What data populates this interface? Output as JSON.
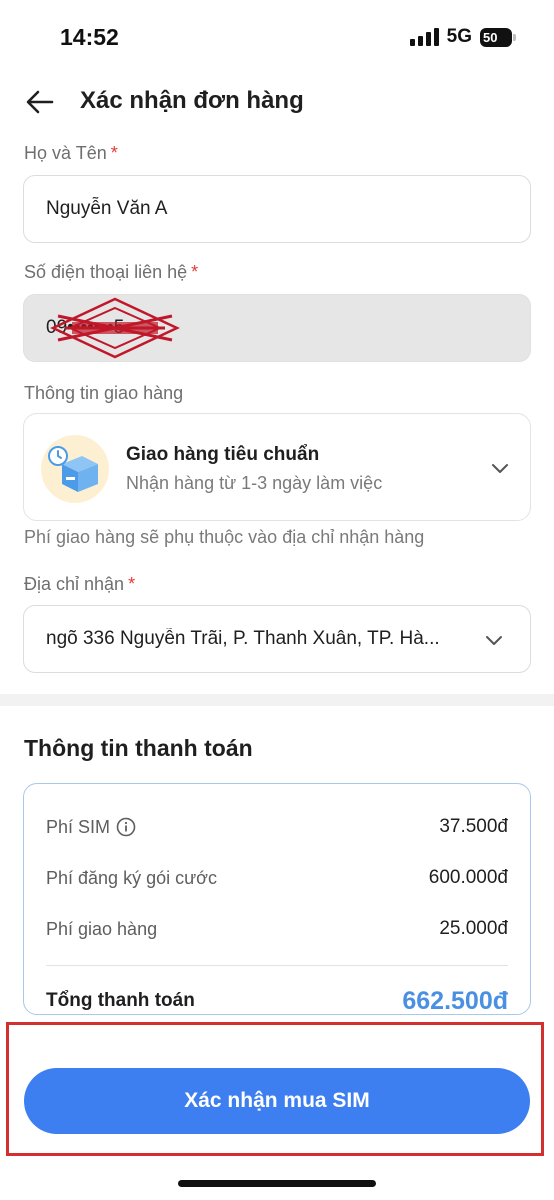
{
  "status_bar": {
    "time": "14:52",
    "network": "5G",
    "battery": "50"
  },
  "header": {
    "title": "Xác nhận đơn hàng"
  },
  "form": {
    "name_label": "Họ và Tên",
    "name_required": "*",
    "name_value": "Nguyễn Văn A",
    "phone_label": "Số điện thoại liên hệ",
    "phone_required": "*",
    "phone_value": "09•••••••5",
    "shipping_label": "Thông tin giao hàng",
    "shipping_title": "Giao hàng tiêu chuẩn",
    "shipping_subtitle": "Nhận hàng từ 1-3 ngày làm việc",
    "shipping_note": "Phí giao hàng sẽ phụ thuộc vào địa chỉ nhận hàng",
    "address_label": "Địa chỉ nhận",
    "address_required": "*",
    "address_value": "ngõ 336 Nguyễn Trãi, P. Thanh Xuân, TP. Hà..."
  },
  "payment": {
    "title": "Thông tin thanh toán",
    "rows": [
      {
        "label": "Phí SIM",
        "value": "37.500đ"
      },
      {
        "label": "Phí đăng ký gói cước",
        "value": "600.000đ"
      },
      {
        "label": "Phí giao hàng",
        "value": "25.000đ"
      }
    ],
    "total_label": "Tổng thanh toán",
    "total_value": "662.500đ"
  },
  "actions": {
    "confirm_label": "Xác nhận mua SIM"
  },
  "colors": {
    "primary": "#3d7ef0",
    "total": "#4a90e2",
    "required": "#e53935",
    "highlight": "#d32f2f"
  }
}
